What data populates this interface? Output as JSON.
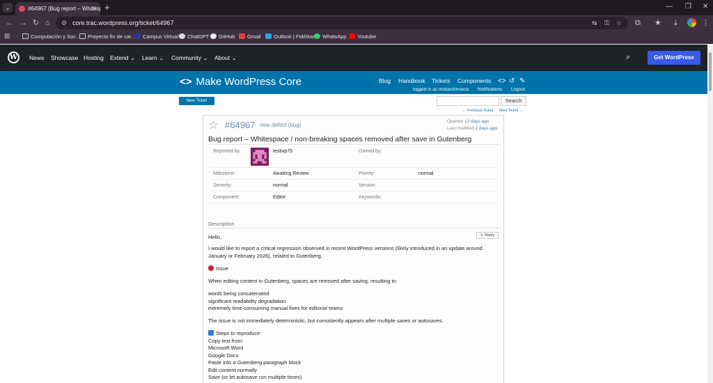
{
  "browser": {
    "tab_title": "#64967 (Bug report – Whitesp…",
    "url": "core.trac.wordpress.org/ticket/64967",
    "new_tab": "+",
    "win_minimize": "—",
    "win_restore": "❐",
    "win_close": "✕",
    "bookmarks": [
      "Computación y Soc...",
      "Proyecto fin de car...",
      "Campus Virtual",
      "ChatGPT",
      "GitHub",
      "Gmail",
      "Outlook | Fidélitas",
      "WhatsApp",
      "Youtube"
    ]
  },
  "wp_header": {
    "logo": "W",
    "nav": [
      "News",
      "Showcase",
      "Hosting",
      "Extend",
      "Learn",
      "Community",
      "About"
    ],
    "cta": "Get WordPress"
  },
  "make_banner": {
    "title": "Make WordPress Core",
    "nav": [
      "Blog",
      "Handbook",
      "Tickets",
      "Components"
    ],
    "logged_in": "logged in as moisesfonseca",
    "notifications": "Notifications",
    "logout": "Logout"
  },
  "trac": {
    "new_ticket": "New Ticket",
    "search_button": "Search",
    "prev_ticket": "← Previous Ticket",
    "next_ticket": "Next Ticket →"
  },
  "ticket": {
    "id": "#64967",
    "type": "new defect (bug)",
    "opened_label": "Opened",
    "opened": "12 days ago",
    "modified_label": "Last modified",
    "modified": "2 days ago",
    "summary": "Bug report – Whitespace / non-breaking spaces removed after save in Gutenberg",
    "fields": {
      "reported_by_label": "Reported by:",
      "reported_by": "testwp75",
      "owned_by_label": "Owned by:",
      "milestone_label": "Milestone:",
      "milestone": "Awaiting Review",
      "priority_label": "Priority:",
      "priority": "normal",
      "severity_label": "Severity:",
      "severity": "normal",
      "version_label": "Version:",
      "component_label": "Component:",
      "component": "Editor",
      "keywords_label": "Keywords:"
    },
    "description_label": "Description",
    "reply": "↳ Reply",
    "description": {
      "hello": "Hello,",
      "intro": "I would like to report a critical regression observed in recent WordPress versions (likely introduced in an update around January or February 2026), related to Gutenberg.",
      "issue_heading": "Issue",
      "when_editing": "When editing content in Gutenberg, spaces are removed after saving, resulting in:",
      "results": [
        "words being concatenated",
        "significant readability degradation",
        "extremely time-consuming manual fixes for editorial teams"
      ],
      "not_deterministic": "The issue is not immediately deterministic, but consistently appears after multiple saves or autosaves.",
      "steps_heading": "Steps to reproduce",
      "steps": [
        "Copy text from:",
        "Microsoft Word",
        "Google Docs",
        "Paste into a Gutenberg paragraph block",
        "Edit content normally",
        "Save (or let autosave run multiple times)"
      ]
    }
  }
}
